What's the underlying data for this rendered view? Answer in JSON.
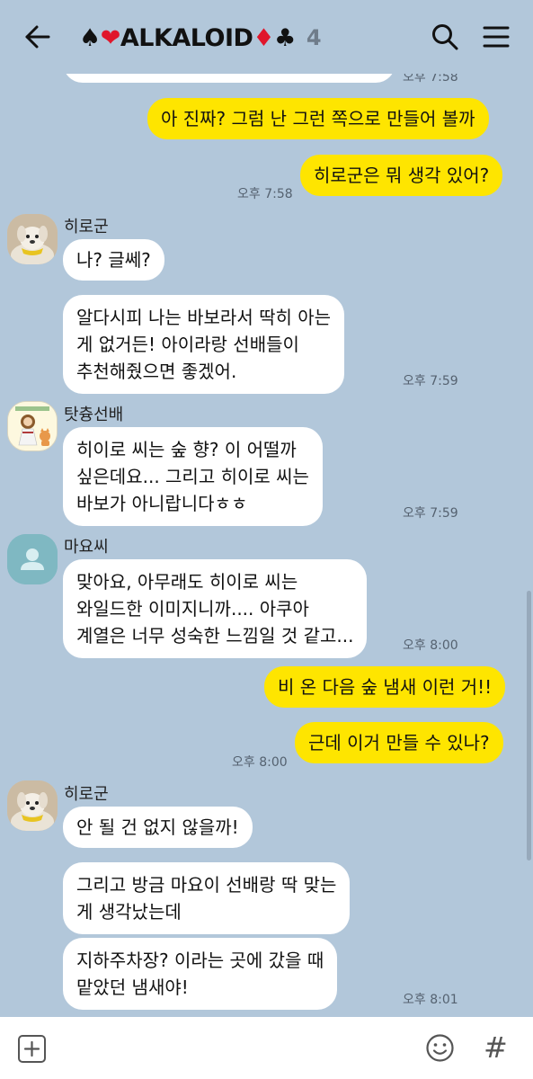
{
  "header": {
    "suit_spade": "♠",
    "suit_heart": "❤",
    "name": "ALKALOID",
    "suit_diamond": "♦",
    "suit_club": "♣",
    "member_count": "4",
    "back_icon": "arrow-left-icon",
    "search_icon": "search-icon",
    "menu_icon": "hamburger-menu-icon"
  },
  "messages": {
    "top_time": "오후 7:58",
    "m1": "아 진짜? 그럼 난 그런 쪽으로 만들어 볼까",
    "m2": "히로군은 뭐 생각 있어?",
    "m2_time": "오후 7:58",
    "hiro_name": "히로군",
    "h1": "나? 글쎄?",
    "h2_l1": "알다시피 나는 바보라서 딱히 아는",
    "h2_l2": "게 없거든! 아이라랑 선배들이",
    "h2_l3": "추천해줬으면 좋겠어.",
    "h2_time": "오후 7:59",
    "tat_name": "탓츙선배",
    "t1_l1": "히이로 씨는 숲 향? 이 어떨까",
    "t1_l2": "싶은데요... 그리고 히이로 씨는",
    "t1_l3": "바보가 아니랍니다ㅎㅎ",
    "t1_time": "오후 7:59",
    "mayo_name": "마요씨",
    "y1_l1": "맞아요, 아무래도 히이로 씨는",
    "y1_l2": "와일드한 이미지니까.... 아쿠아",
    "y1_l3": "계열은 너무 성숙한 느낌일 것 같고...",
    "y1_time": "오후 8:00",
    "m3": "비 온 다음 숲 냄새 이런 거!!",
    "m4": "근데 이거 만들 수 있나?",
    "m4_time": "오후 8:00",
    "hiro_name2": "히로군",
    "h3": "안 될 건 없지 않을까!",
    "h4_l1": "그리고 방금 마요이 선배랑 딱 맞는",
    "h4_l2": "게 생각났는데",
    "h5_l1": "지하주차장? 이라는 곳에 갔을 때",
    "h5_l2": "맡았던 냄새야!",
    "h5_time": "오후 8:01"
  },
  "colors": {
    "background": "#b2c7da",
    "my_bubble": "#fee500",
    "other_bubble": "#ffffff"
  },
  "bottom": {
    "plus_icon": "plus-box-icon",
    "emoji_icon": "smiley-icon",
    "hash_label": "#"
  }
}
